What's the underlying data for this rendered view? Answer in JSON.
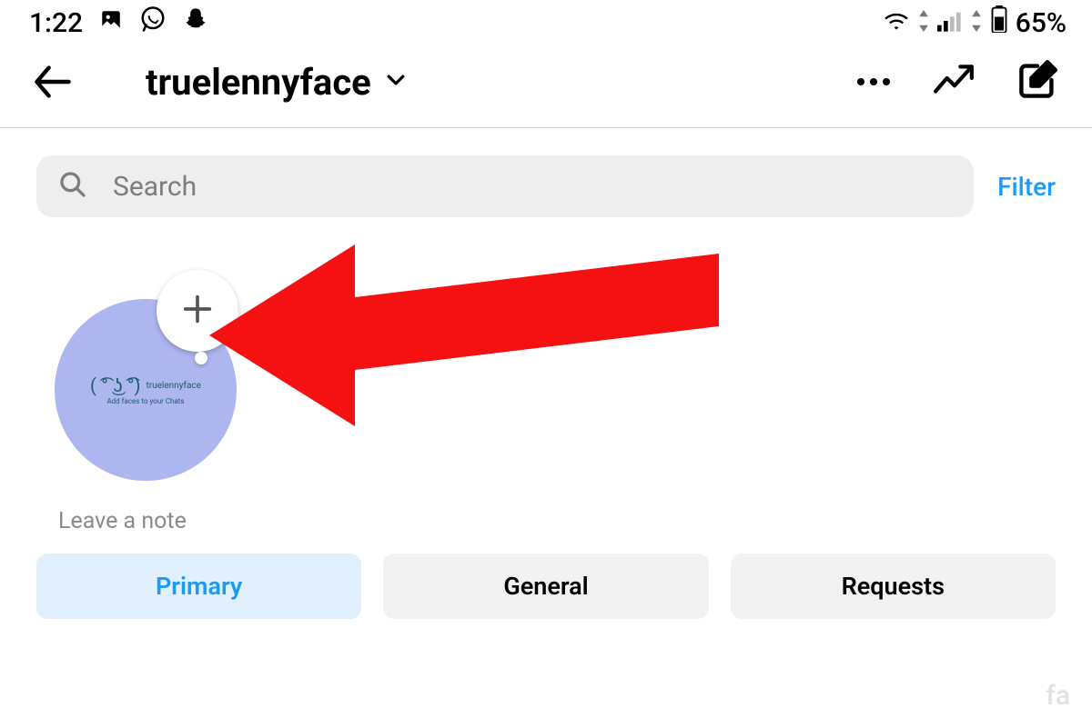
{
  "status": {
    "time": "1:22",
    "battery": "65%"
  },
  "header": {
    "username": "truelennyface"
  },
  "search": {
    "placeholder": "Search",
    "filter_label": "Filter"
  },
  "note": {
    "leave_note_label": "Leave a note",
    "avatar_name": "truelennyface",
    "avatar_tag": "Add faces to your Chats"
  },
  "tabs": {
    "primary": "Primary",
    "general": "General",
    "requests": "Requests"
  },
  "watermark": "fa"
}
